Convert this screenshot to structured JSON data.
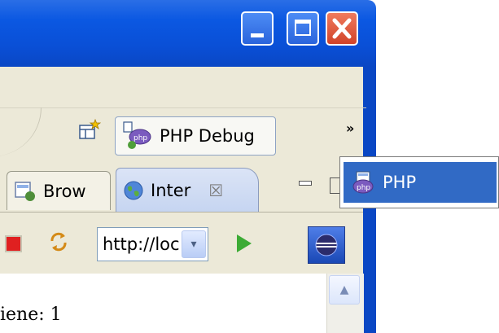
{
  "window": {
    "minimize_label": "",
    "maximize_label": "",
    "close_label": ""
  },
  "toolbar": {
    "perspective_button_label": "PHP Debug",
    "overflow_chevron": "»"
  },
  "tabs": [
    {
      "label": "Brow"
    },
    {
      "label": "Inter",
      "close": "☒"
    }
  ],
  "browser": {
    "url_value": "http://loc",
    "dropdown_glyph": "▾"
  },
  "content": {
    "text": "iene: 1",
    "scroll_up_glyph": "▲"
  },
  "popup": {
    "items": [
      {
        "label": "PHP"
      }
    ]
  },
  "colors": {
    "titlebar": "#0a4fd6",
    "selection": "#316ac5",
    "close_button": "#d1432a",
    "stop": "#e02020",
    "go": "#3dab35"
  }
}
